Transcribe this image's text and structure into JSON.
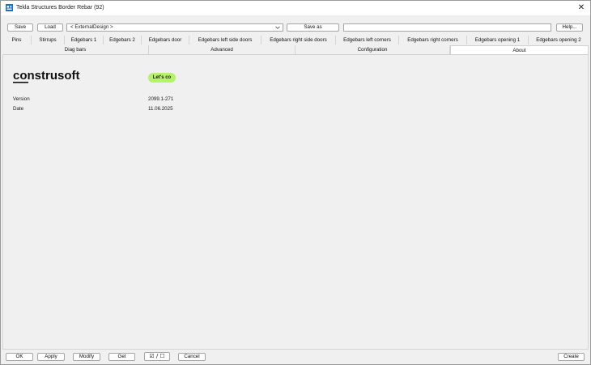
{
  "window": {
    "title": "Tekla Structures  Border Rebar (92)",
    "close_glyph": "✕"
  },
  "toolbar": {
    "save_label": "Save",
    "load_label": "Load",
    "attribute_set": "< ExternalDesign >",
    "save_as_label": "Save as",
    "save_as_name": "",
    "help_label": "Help..."
  },
  "tabs_row1": [
    "Pins",
    "Stirrups",
    "Edgebars 1",
    "Edgebars 2",
    "Edgebars door",
    "Edgebars left side doors",
    "Edgebars right side doors",
    "Edgebars left corners",
    "Edgebars right corners",
    "Edgebars opening 1",
    "Edgebars opening 2"
  ],
  "tabs_row2": [
    "Diag bars",
    "Advanced",
    "Configuration",
    "About"
  ],
  "active_tab": "About",
  "about": {
    "logo_text": "construsoft",
    "badge_text": "Let's co",
    "version_label": "Version",
    "version_value": "2099.1-271",
    "date_label": "Date",
    "date_value": "11.06.2025"
  },
  "bottom": {
    "ok_label": "OK",
    "apply_label": "Apply",
    "modify_label": "Modify",
    "get_label": "Get",
    "toggle_label": "☑ / ☐",
    "cancel_label": "Cancel",
    "create_label": "Create"
  },
  "colors": {
    "badge": "#b7f26b",
    "app_icon": "#1d6fc4"
  },
  "icons": {
    "app": "tekla-app-icon",
    "close": "close-icon",
    "dropdown": "chevron-down-icon"
  }
}
